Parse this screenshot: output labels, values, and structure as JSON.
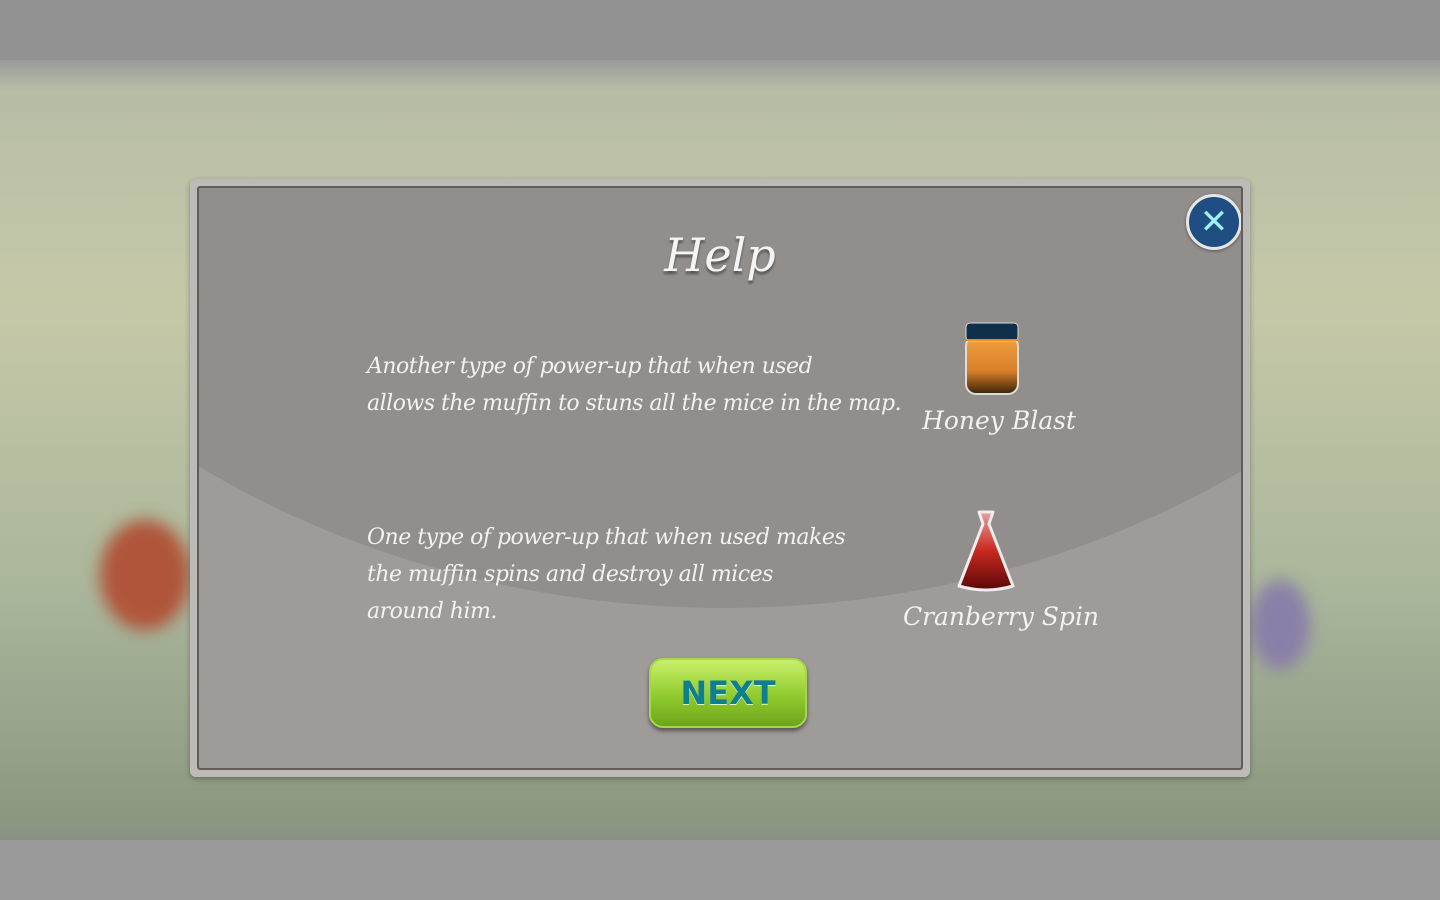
{
  "dialog": {
    "title": "Help",
    "close_icon": "close-x-icon",
    "items": [
      {
        "name": "Honey Blast",
        "icon": "honey-jar-icon",
        "description_lines": [
          "Another type of power-up that when used",
          "allows the muffin to stuns all the mice in the map."
        ]
      },
      {
        "name": "Cranberry Spin",
        "icon": "cranberry-flask-icon",
        "description_lines": [
          "One type of power-up that when used makes",
          "the muffin spins and destroy all mices",
          "around him."
        ]
      }
    ],
    "next_label": "NEXT"
  },
  "colors": {
    "next_button": "#8bc72a",
    "next_text": "#0f7f8f",
    "close_button": "#1f4e82"
  }
}
